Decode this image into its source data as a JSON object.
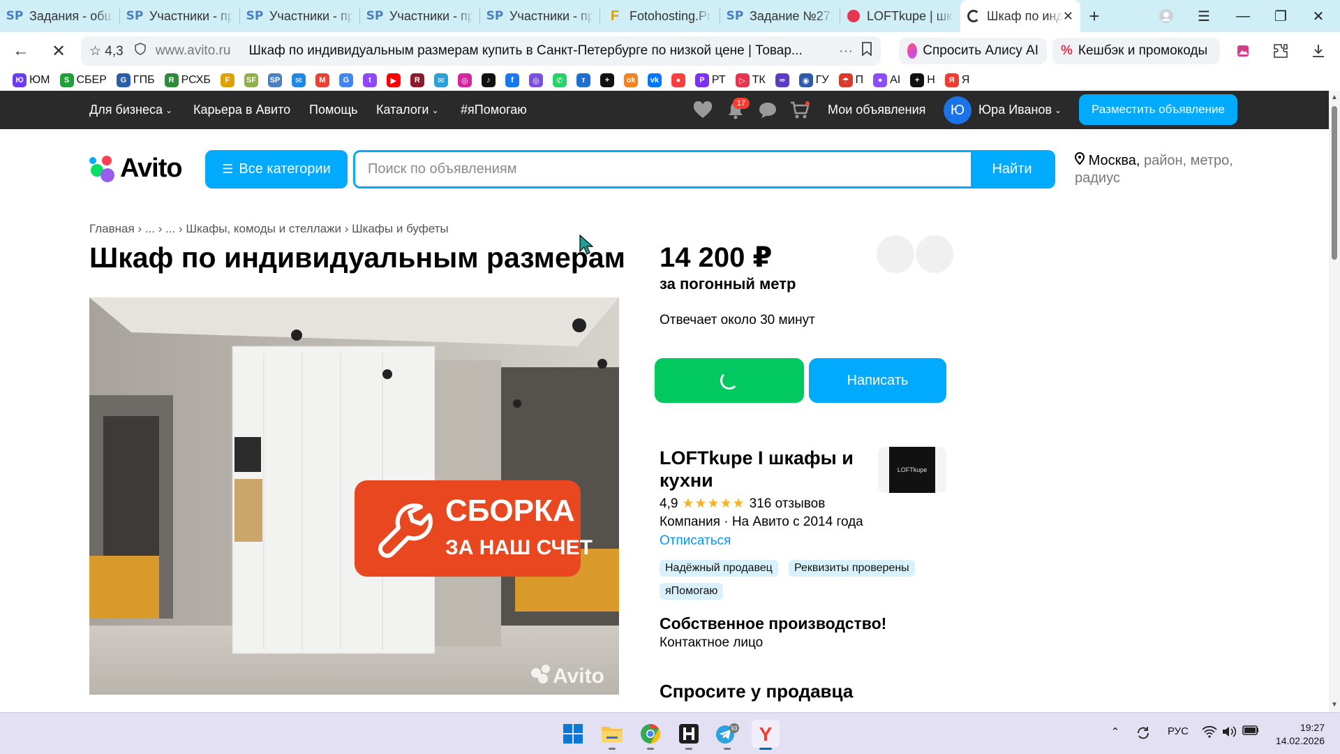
{
  "browser": {
    "tabs": [
      {
        "icon": "SP",
        "kind": "sp",
        "label": "Задания - общ"
      },
      {
        "icon": "SP",
        "kind": "sp",
        "label": "Участники - пр"
      },
      {
        "icon": "SP",
        "kind": "sp",
        "label": "Участники - пр"
      },
      {
        "icon": "SP",
        "kind": "sp",
        "label": "Участники - пр"
      },
      {
        "icon": "SP",
        "kind": "sp",
        "label": "Участники - пр"
      },
      {
        "icon": "F",
        "kind": "ft",
        "label": "Fotohosting.Pr"
      },
      {
        "icon": "SP",
        "kind": "sp",
        "label": "Задание №272"
      },
      {
        "icon": "",
        "kind": "loft",
        "label": "LOFTkupe | шка"
      },
      {
        "icon": "",
        "kind": "spin",
        "label": "Шкаф по инд",
        "active": true
      }
    ],
    "rating": "☆ 4,3",
    "domain": "www.avito.ru",
    "page_title": "Шкаф по индивидуальным размерам купить в Санкт-Петербурге по низкой цене | Товар...",
    "alice_label": "Спросить Алису AI",
    "cashback_label": "Кешбэк и промокоды",
    "bookmarks": [
      {
        "label": "ЮМ",
        "color": "#6b3cf6",
        "glyph": "Ю"
      },
      {
        "label": "СБЕР",
        "color": "#21a038",
        "glyph": "S"
      },
      {
        "label": "ГПБ",
        "color": "#2a5ea8",
        "glyph": "G"
      },
      {
        "label": "РСХБ",
        "color": "#2f8a3c",
        "glyph": "R"
      },
      {
        "label": "",
        "color": "#e0a000",
        "glyph": "F"
      },
      {
        "label": "",
        "color": "#8fb04a",
        "glyph": "SF"
      },
      {
        "label": "",
        "color": "#4a7fc1",
        "glyph": "SP"
      },
      {
        "label": "",
        "color": "#1e88e5",
        "glyph": "✉"
      },
      {
        "label": "",
        "color": "#ea4335",
        "glyph": "M"
      },
      {
        "label": "",
        "color": "#4285f4",
        "glyph": "G"
      },
      {
        "label": "",
        "color": "#9146ff",
        "glyph": "t"
      },
      {
        "label": "",
        "color": "#ff0000",
        "glyph": "▶"
      },
      {
        "label": "",
        "color": "#8a1c2c",
        "glyph": "R"
      },
      {
        "label": "",
        "color": "#2f9fd8",
        "glyph": "✉"
      },
      {
        "label": "",
        "color": "#d6249f",
        "glyph": "◎"
      },
      {
        "label": "",
        "color": "#111111",
        "glyph": "♪"
      },
      {
        "label": "",
        "color": "#1877f2",
        "glyph": "f"
      },
      {
        "label": "",
        "color": "#7b4fe0",
        "glyph": "◎"
      },
      {
        "label": "",
        "color": "#25d366",
        "glyph": "✆"
      },
      {
        "label": "",
        "color": "#1f6fd1",
        "glyph": "т"
      },
      {
        "label": "",
        "color": "#111111",
        "glyph": "+"
      },
      {
        "label": "",
        "color": "#f58220",
        "glyph": "ok"
      },
      {
        "label": "",
        "color": "#0077ff",
        "glyph": "vk"
      },
      {
        "label": "",
        "color": "#ff3d3d",
        "glyph": "●"
      },
      {
        "label": "РТ",
        "color": "#7b2ff7",
        "glyph": "P"
      },
      {
        "label": "ТК",
        "color": "#e8344e",
        "glyph": "▷"
      },
      {
        "label": "",
        "color": "#5b3cc4",
        "glyph": "∞"
      },
      {
        "label": "ГУ",
        "color": "#2d5aa8",
        "glyph": "◉"
      },
      {
        "label": "П",
        "color": "#d93a2b",
        "glyph": "☂"
      },
      {
        "label": "AI",
        "color": "#8c4dff",
        "glyph": "●"
      },
      {
        "label": "Н",
        "color": "#111111",
        "glyph": "+"
      },
      {
        "label": "Я",
        "color": "#f33c2f",
        "glyph": "Я"
      }
    ]
  },
  "avito_nav": {
    "business": "Для бизнеса",
    "career": "Карьера в Авито",
    "help": "Помощь",
    "catalogs": "Каталоги",
    "ya_help": "#яПомогаю",
    "notifications_count": "17",
    "my_ads": "Мои объявления",
    "avatar_letter": "Ю",
    "user_name": "Юра Иванов",
    "post_ad": "Разместить объявление"
  },
  "header": {
    "logo_text": "Avito",
    "categories_label": "Все категории",
    "search_placeholder": "Поиск по объявлениям",
    "find_label": "Найти",
    "location_city": "Москва,",
    "location_rest": " район, метро, радиус"
  },
  "listing": {
    "breadcrumbs": [
      "Главная",
      "...",
      "...",
      "Шкафы, комоды и стеллажи",
      "Шкафы и буфеты"
    ],
    "title": "Шкаф по индивидуальным размерам",
    "banner_line1": "СБОРКА",
    "banner_line2": "ЗА НАШ СЧЕТ",
    "watermark": "Avito",
    "price": "14 200 ₽",
    "price_unit": "за погонный метр",
    "reply_time": "Отвечает около 30 минут",
    "write_label": "Написать"
  },
  "seller": {
    "name": "LOFTkupe I шкафы и кухни",
    "logo_text": "LOFTkupe",
    "rating": "4,9",
    "stars": "★★★★★",
    "reviews": "316 отзывов",
    "company": "Компания · На Авито с 2014 года",
    "unsubscribe": "Отписаться",
    "tags": [
      "Надёжный продавец",
      "Реквизиты проверены",
      "яПомогаю"
    ],
    "own_production": "Собственное производство!",
    "contact_person": "Контактное лицо",
    "ask_heading": "Спросите у продавца"
  },
  "taskbar": {
    "telegram_badge": "93",
    "lang": "РУС",
    "time": "19:27",
    "date": "14.02.2026"
  },
  "colors": {
    "avito_blue": "#00aaff",
    "call_green": "#02c95f",
    "nav_dark": "#2a2a2a",
    "banner_red": "#e8471f",
    "tab_strip": "#cfeef6"
  }
}
